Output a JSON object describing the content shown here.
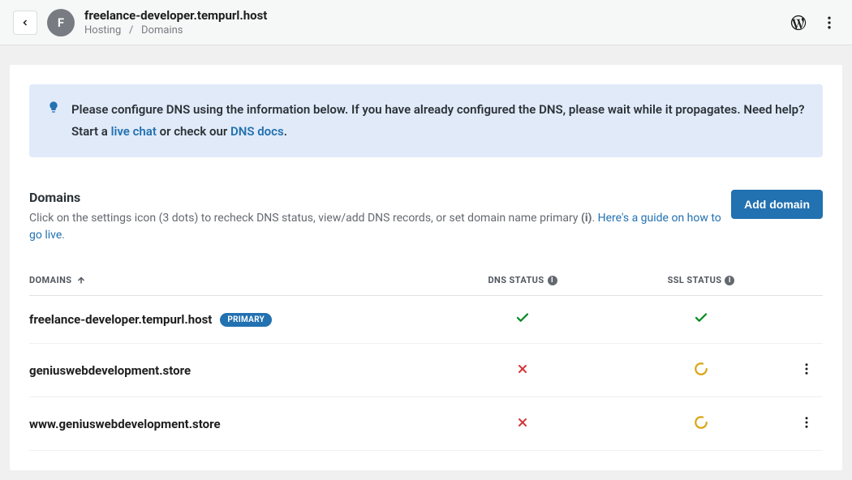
{
  "header": {
    "avatar_initial": "F",
    "site_title": "freelance-developer.tempurl.host",
    "breadcrumb_parent": "Hosting",
    "breadcrumb_sep": "/",
    "breadcrumb_current": "Domains"
  },
  "alert": {
    "text_1": "Please configure DNS using the information below. If you have already configured the DNS, please wait while it propagates. Need help? Start a ",
    "link_1": "live chat",
    "text_2": " or check our ",
    "link_2": "DNS docs",
    "text_3": "."
  },
  "section": {
    "title": "Domains",
    "sub_1": "Click on the settings icon (3 dots) to recheck DNS status, view/add DNS records, or set domain name primary ",
    "sub_2": "(i)",
    "sub_3": ". ",
    "guide_link": "Here's a guide on how to go live",
    "sub_4": ".",
    "add_button": "Add domain"
  },
  "columns": {
    "domains": "DOMAINS",
    "dns": "DNS STATUS",
    "ssl": "SSL STATUS"
  },
  "rows": [
    {
      "domain": "freelance-developer.tempurl.host",
      "primary": true,
      "primary_badge": "PRIMARY",
      "dns": "ok",
      "ssl": "ok",
      "has_actions": false
    },
    {
      "domain": "geniuswebdevelopment.store",
      "primary": false,
      "dns": "fail",
      "ssl": "pending",
      "has_actions": true
    },
    {
      "domain": "www.geniuswebdevelopment.store",
      "primary": false,
      "dns": "fail",
      "ssl": "pending",
      "has_actions": true
    }
  ]
}
